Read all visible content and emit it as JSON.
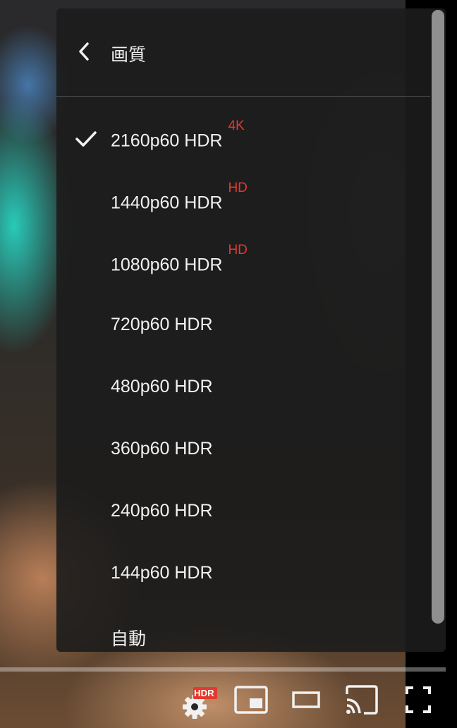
{
  "menu": {
    "title": "画質",
    "items": [
      {
        "label": "2160p60 HDR",
        "badge": "4K",
        "selected": true
      },
      {
        "label": "1440p60 HDR",
        "badge": "HD",
        "selected": false
      },
      {
        "label": "1080p60 HDR",
        "badge": "HD",
        "selected": false
      },
      {
        "label": "720p60 HDR",
        "badge": "",
        "selected": false
      },
      {
        "label": "480p60 HDR",
        "badge": "",
        "selected": false
      },
      {
        "label": "360p60 HDR",
        "badge": "",
        "selected": false
      },
      {
        "label": "240p60 HDR",
        "badge": "",
        "selected": false
      },
      {
        "label": "144p60 HDR",
        "badge": "",
        "selected": false
      },
      {
        "label": "自動",
        "badge": "",
        "selected": false
      }
    ]
  },
  "controls": {
    "settings_badge": "HDR",
    "icons": [
      "settings-icon",
      "miniplayer-icon",
      "theater-mode-icon",
      "cast-icon",
      "fullscreen-icon"
    ]
  },
  "colors": {
    "badge_red": "#e23a2e",
    "menu_bg": "#1c1c1c",
    "text": "#f1f1f1"
  }
}
